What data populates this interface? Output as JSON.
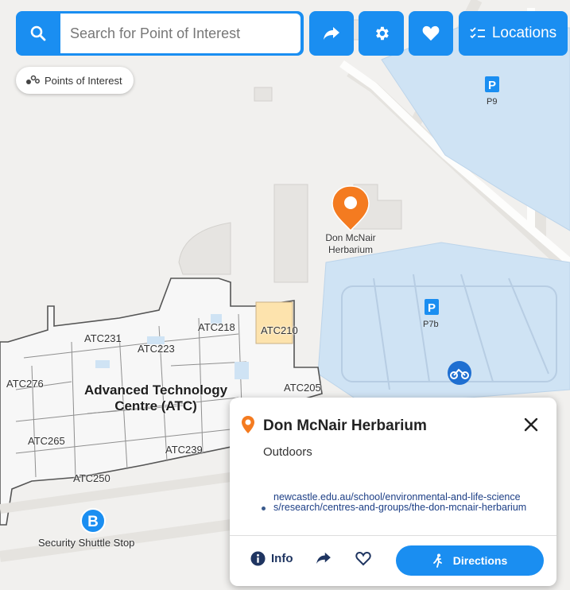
{
  "search": {
    "placeholder": "Search for Point of Interest"
  },
  "toolbar": {
    "locations_label": "Locations"
  },
  "poi_chip": {
    "label": "Points of Interest"
  },
  "map": {
    "buildings": [
      {
        "name": "Advanced Technology\nCentre (ATC)",
        "label": "Advanced Technology Centre (ATC)"
      }
    ],
    "building_label_line1": "Advanced Technology",
    "building_label_line2": "Centre (ATC)",
    "rooms": [
      "ATC276",
      "ATC231",
      "ATC223",
      "ATC218",
      "ATC210",
      "ATC205",
      "ATC265",
      "ATC239",
      "ATC250"
    ],
    "poi_marker_line1": "Don McNair",
    "poi_marker_line2": "Herbarium",
    "parking": [
      {
        "badge": "P",
        "label": "P9"
      },
      {
        "badge": "P",
        "label": "P7b"
      }
    ],
    "shuttle": {
      "badge": "B",
      "label": "Security Shuttle Stop"
    }
  },
  "card": {
    "title": "Don McNair Herbarium",
    "subtitle": "Outdoors",
    "link": "newcastle.edu.au/school/environmental-and-life-sciences/research/centres-and-groups/the-don-mcnair-herbarium",
    "info_label": "Info",
    "directions_label": "Directions"
  },
  "colors": {
    "accent": "#1a8ef1",
    "marker": "#f47b20",
    "parking_fill": "#cfe3f4",
    "building_fill": "#f7f7f7",
    "room_highlight": "#fde3ad",
    "map_background": "#f1f0ee"
  },
  "icons": [
    "search-icon",
    "share-arrow-icon",
    "gear-icon",
    "heart-icon",
    "checklist-icon",
    "poi-dots-icon",
    "location-pin-icon",
    "close-icon",
    "info-icon",
    "walking-icon",
    "motorbike-icon",
    "bus-stop-icon"
  ]
}
